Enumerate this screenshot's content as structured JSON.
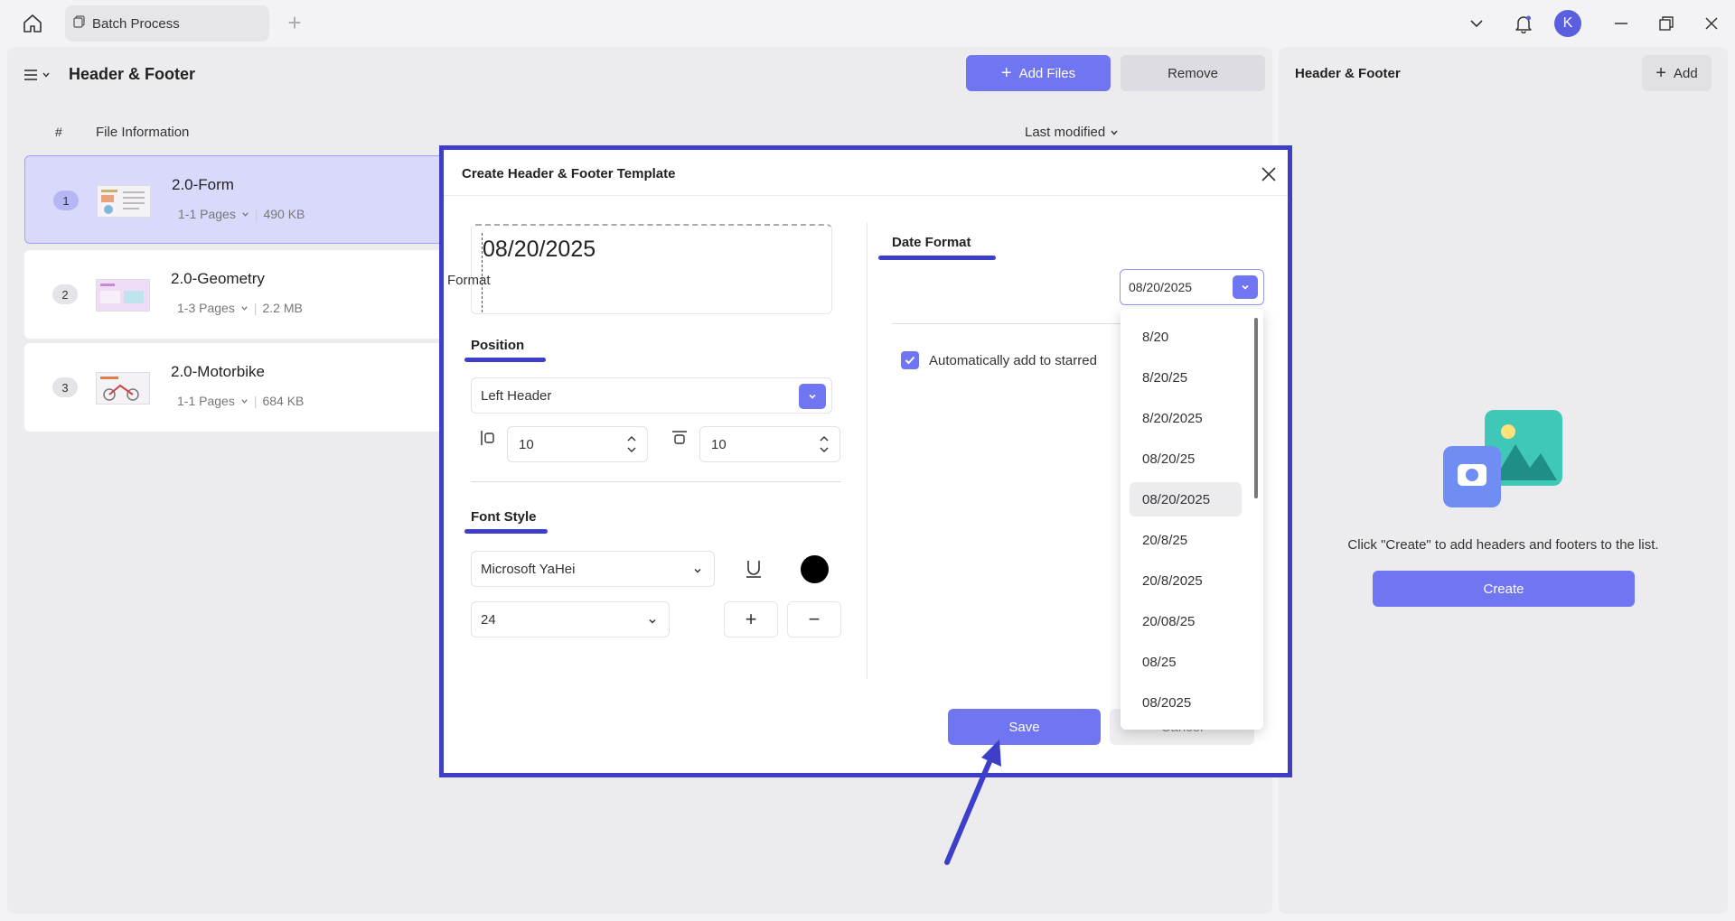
{
  "titlebar": {
    "tab_label": "Batch Process",
    "avatar_letter": "K"
  },
  "main": {
    "title": "Header & Footer",
    "add_files_label": "Add Files",
    "remove_label": "Remove",
    "columns": {
      "index": "#",
      "info": "File Information",
      "modified": "Last modified"
    },
    "files": [
      {
        "index": "1",
        "name": "2.0-Form",
        "pages": "1-1 Pages",
        "size": "490 KB"
      },
      {
        "index": "2",
        "name": "2.0-Geometry",
        "pages": "1-3 Pages",
        "size": "2.2 MB"
      },
      {
        "index": "3",
        "name": "2.0-Motorbike",
        "pages": "1-1 Pages",
        "size": "684 KB"
      }
    ]
  },
  "right_panel": {
    "title": "Header & Footer",
    "add_label": "Add",
    "hint": "Click \"Create\" to add headers and footers to the list.",
    "create_label": "Create"
  },
  "dialog": {
    "title": "Create Header & Footer Template",
    "preview_text": "08/20/2025",
    "position_label": "Position",
    "position_value": "Left Header",
    "margin_left": "10",
    "margin_top": "10",
    "font_style_label": "Font Style",
    "font_name": "Microsoft YaHei",
    "font_size": "24",
    "font_color": "#000000",
    "plus": "+",
    "minus": "−",
    "date_format_label": "Date Format",
    "format_label": "Format",
    "format_value": "08/20/2025",
    "auto_star_label": "Automatically add to starred",
    "save_label": "Save",
    "cancel_label": "Cancel",
    "format_options": [
      "8/20",
      "8/20/25",
      "8/20/2025",
      "08/20/25",
      "08/20/2025",
      "20/8/25",
      "20/8/2025",
      "20/08/25",
      "08/25",
      "08/2025"
    ],
    "selected_option": "08/20/2025"
  },
  "colors": {
    "accent": "#7075f2",
    "annotation": "#3d3fc8",
    "selected_row": "#d9dafb"
  },
  "icons": [
    "home-icon",
    "batch-icon",
    "plus-icon",
    "chevron-down-icon",
    "bell-icon",
    "minimize-icon",
    "restore-icon",
    "close-icon",
    "menu-icon",
    "underline-icon",
    "align-left-margin-icon",
    "align-top-margin-icon",
    "checkmark-icon",
    "image-illustration-icon"
  ]
}
